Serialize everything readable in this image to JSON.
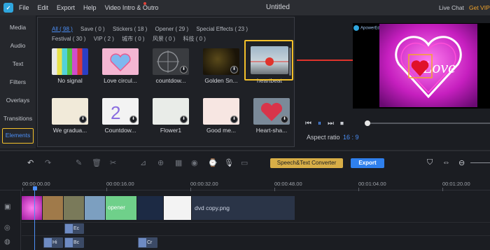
{
  "app": {
    "menu": [
      "File",
      "Edit",
      "Export",
      "Help",
      "Video Intro & Outro"
    ],
    "title": "Untitled",
    "live_chat": "Live Chat",
    "get_vip": "Get VIP"
  },
  "sidebar": {
    "items": [
      {
        "label": "Media"
      },
      {
        "label": "Audio"
      },
      {
        "label": "Text"
      },
      {
        "label": "Filters"
      },
      {
        "label": "Overlays"
      },
      {
        "label": "Transitions"
      },
      {
        "label": "Elements"
      }
    ],
    "active": "Elements"
  },
  "library": {
    "categories": [
      {
        "label": "All ( 98 )",
        "active": true
      },
      {
        "label": "Save ( 0 )"
      },
      {
        "label": "Stickers ( 18 )"
      },
      {
        "label": "Opener ( 29 )"
      },
      {
        "label": "Special Effects ( 23 )"
      },
      {
        "label": "Festival ( 30 )"
      },
      {
        "label": "VIP ( 2 )"
      },
      {
        "label": "城市 ( 0 )"
      },
      {
        "label": "风景 ( 0 )"
      },
      {
        "label": "科技 ( 0 )"
      }
    ],
    "items": [
      {
        "label": "No signal"
      },
      {
        "label": "Love circul..."
      },
      {
        "label": "countdow..."
      },
      {
        "label": "Golden Sn..."
      },
      {
        "label": "heartbeat"
      },
      {
        "label": "We gradua..."
      },
      {
        "label": "Countdow..."
      },
      {
        "label": "Flower1"
      },
      {
        "label": "Good me..."
      },
      {
        "label": "Heart-sha..."
      }
    ],
    "selected": "heartbeat"
  },
  "preview": {
    "watermark": "ApowerEdit",
    "aspect_label": "Aspect ratio",
    "aspect_value": "16 : 9",
    "overlay_text": "Love"
  },
  "toolbar": {
    "speech_text": "Speech&Text Converter",
    "export": "Export"
  },
  "timeline": {
    "ticks": [
      "00:00:00.00",
      "00:00:16.00",
      "00:00:32.00",
      "00:00:48.00",
      "00:01:04.00",
      "00:01:20.00"
    ],
    "clip_label": "dvd copy.png",
    "clip_opener": "opener",
    "text_clip": "Ec",
    "sub_clips": [
      "Hi",
      "Bc",
      "Cr"
    ]
  },
  "colors": {
    "accent": "#4c8ff7",
    "highlight": "#f3c02a",
    "vip": "#f3a42a",
    "arrow": "#e0332b",
    "speech_button": "#d8ae47",
    "export_button": "#2f80ed"
  }
}
